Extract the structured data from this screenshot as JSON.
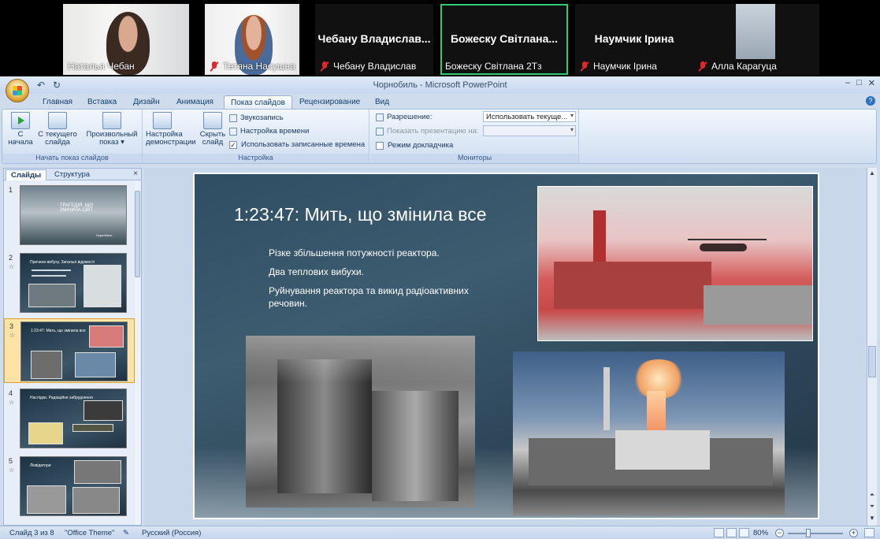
{
  "meeting": {
    "participants": [
      {
        "name": "Наталья Чебан",
        "muted": false
      },
      {
        "name": "Тетяна Насушна",
        "muted": true
      },
      {
        "display": "Чебану Владислав...",
        "name": "Чебану Владислав",
        "muted": true
      },
      {
        "display": "Божеску Світлана...",
        "name": "Божеску Світлана 2Тз",
        "muted": false,
        "active": true
      },
      {
        "display": "Наумчик Ірина",
        "name": "Наумчик Ірина",
        "muted": true
      },
      {
        "name": "Алла Карагуца",
        "muted": true
      }
    ]
  },
  "window": {
    "title": "Чорнобиль - Microsoft PowerPoint",
    "qat_undo": "↶",
    "qat_redo": "↻",
    "controls": [
      "‒",
      "□",
      "✕"
    ]
  },
  "tabs": [
    "Главная",
    "Вставка",
    "Дизайн",
    "Анимация",
    "Показ слайдов",
    "Рецензирование",
    "Вид"
  ],
  "selected_tab": "Показ слайдов",
  "ribbon": {
    "start_group": {
      "label": "Начать показ слайдов",
      "from_start": "С начала",
      "from_current": "С текущего слайда",
      "custom_show": "Произвольный показ"
    },
    "setup_group": {
      "label": "Настройка",
      "setup_show": "Настройка демонстрации",
      "hide_slide": "Скрыть слайд",
      "record_narration": "Звукозапись",
      "rehearse_timings": "Настройка времени",
      "use_timings": "Использовать записанные времена",
      "use_timings_checked": true
    },
    "monitors_group": {
      "label": "Мониторы",
      "resolution_label": "Разрешение:",
      "resolution_value": "Использовать текуще...",
      "show_on_label": "Показать презентацию на:",
      "presenter_view": "Режим докладчика",
      "presenter_view_checked": false
    }
  },
  "slides_panel": {
    "tab_slides": "Слайды",
    "tab_outline": "Структура",
    "close": "×",
    "thumbnails": [
      {
        "num": "1",
        "title": "ТРАГЕДІЯ, ЩО ЗМІНИЛА СВІТ",
        "caption": "Чорнобиль"
      },
      {
        "num": "2",
        "title": "Причини вибуху. Загальні відомості"
      },
      {
        "num": "3",
        "title": "1:23:47: Мить, що змінила все"
      },
      {
        "num": "4",
        "title": "Наслідки. Радіаційне забруднення"
      },
      {
        "num": "5",
        "title": "Ліквідатори"
      }
    ],
    "selected": "3"
  },
  "slide": {
    "title": "1:23:47: Мить, що змінила все",
    "bullets": [
      "Різке збільшення потужності реактора.",
      "Два теплових вибухи.",
      "Руйнування реактора та викид радіоактивних речовин."
    ]
  },
  "status": {
    "slide_counter": "Слайд 3 из 8",
    "theme": "\"Office Theme\"",
    "language": "Русский (Россия)",
    "zoom": "80%"
  },
  "colors": {
    "active_speaker": "#2ecc71",
    "mute": "#e02828",
    "ribbon_bg": "#dde8f6",
    "slide_bg": "#2f4e63"
  }
}
